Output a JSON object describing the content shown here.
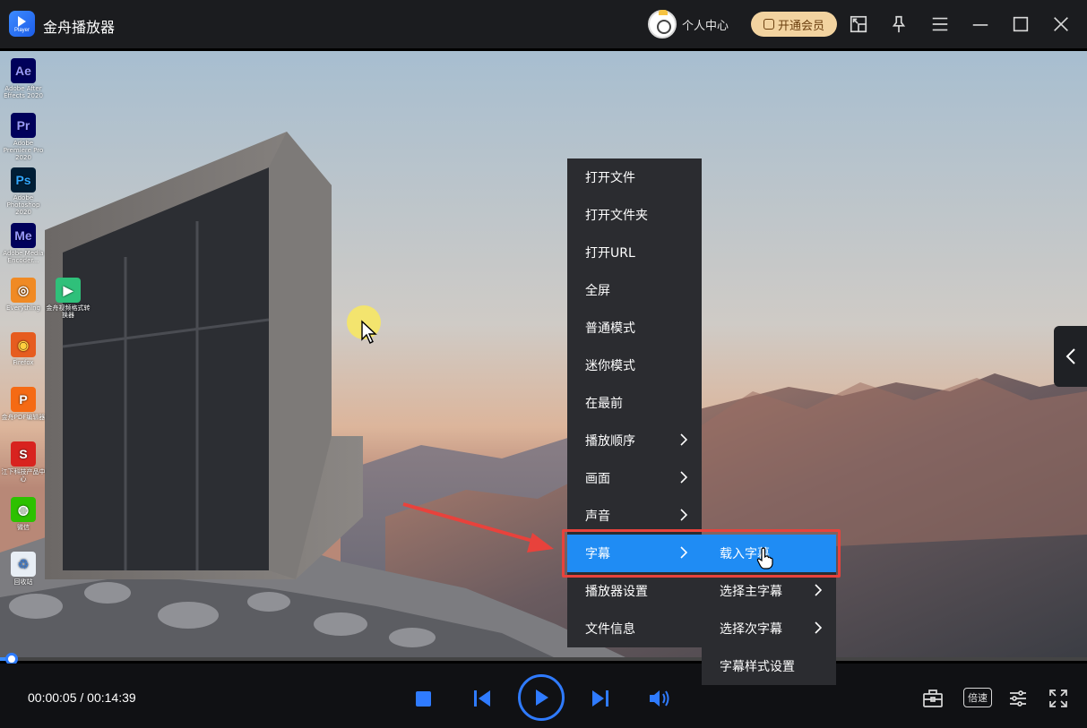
{
  "app": {
    "title": "金舟播放器",
    "logo_label": "Player"
  },
  "header": {
    "user_label": "个人中心",
    "vip_label": "开通会员"
  },
  "desktop_icons": [
    {
      "label": "Adobe After Effects 2020",
      "glyph": "Ae",
      "color": "#00005b",
      "fg": "#9999ff"
    },
    {
      "label": "Adobe Premiere Pro 2020",
      "glyph": "Pr",
      "color": "#00005b",
      "fg": "#9999ff"
    },
    {
      "label": "Adobe Photoshop 2020",
      "glyph": "Ps",
      "color": "#001e36",
      "fg": "#31a8ff"
    },
    {
      "label": "Adobe Media Encoder...",
      "glyph": "Me",
      "color": "#00005b",
      "fg": "#9999ff"
    },
    {
      "label": "Everything",
      "glyph": "◎",
      "color": "#f08a24",
      "fg": "#ffffff"
    },
    {
      "label": "金舟视频格式转换器",
      "glyph": "▶",
      "color": "#2fc07a",
      "fg": "#ffffff"
    },
    {
      "label": "Firefox",
      "glyph": "◉",
      "color": "#e65c1f",
      "fg": "#ffcf3f"
    },
    {
      "label": "金舟PDF编辑器",
      "glyph": "P",
      "color": "#f56a14",
      "fg": "#ffffff"
    },
    {
      "label": "江下科技产品中心",
      "glyph": "S",
      "color": "#d8231f",
      "fg": "#ffffff"
    },
    {
      "label": "微信",
      "glyph": "◍",
      "color": "#2dc100",
      "fg": "#ffffff"
    },
    {
      "label": "回收站",
      "glyph": "♲",
      "color": "#e8eef5",
      "fg": "#3a7ad0"
    }
  ],
  "context_menu": {
    "items": [
      {
        "label": "打开文件",
        "has_submenu": false
      },
      {
        "label": "打开文件夹",
        "has_submenu": false
      },
      {
        "label": "打开URL",
        "has_submenu": false
      },
      {
        "label": "全屏",
        "has_submenu": false
      },
      {
        "label": "普通模式",
        "has_submenu": false
      },
      {
        "label": "迷你模式",
        "has_submenu": false
      },
      {
        "label": "在最前",
        "has_submenu": false
      },
      {
        "label": "播放顺序",
        "has_submenu": true
      },
      {
        "label": "画面",
        "has_submenu": true
      },
      {
        "label": "声音",
        "has_submenu": true
      },
      {
        "label": "字幕",
        "has_submenu": true,
        "active": true
      },
      {
        "label": "播放器设置",
        "has_submenu": false
      },
      {
        "label": "文件信息",
        "has_submenu": false
      }
    ],
    "subtitle_submenu": [
      {
        "label": "载入字幕",
        "has_submenu": false,
        "active": true
      },
      {
        "label": "选择主字幕",
        "has_submenu": true
      },
      {
        "label": "选择次字幕",
        "has_submenu": true
      },
      {
        "label": "字幕样式设置",
        "has_submenu": false
      }
    ]
  },
  "playback": {
    "time_display": "00:00:05 / 00:14:39",
    "progress_fraction": 0.006
  },
  "controls": {
    "speed_label": "倍速"
  },
  "colors": {
    "accent": "#2f7bff",
    "menu_bg": "#2b2c30",
    "menu_active": "#1f8cf4",
    "highlight_box": "#e8423c"
  }
}
